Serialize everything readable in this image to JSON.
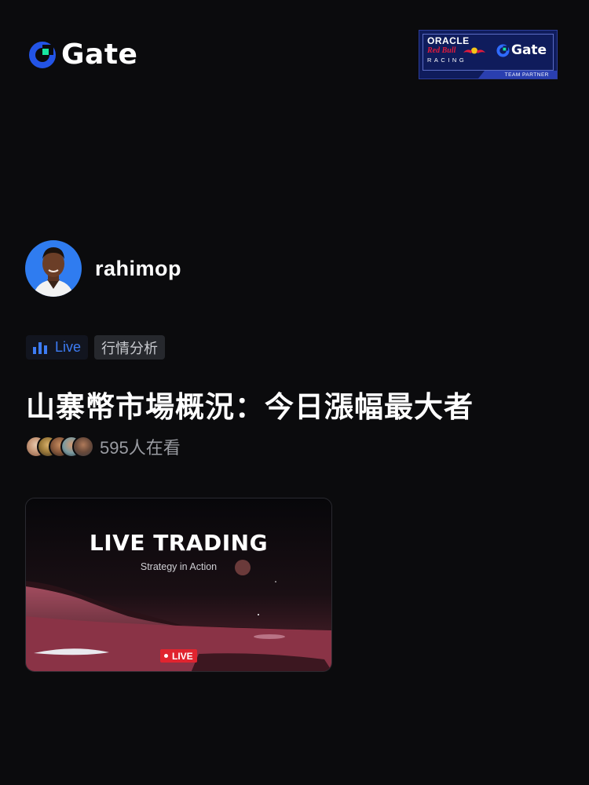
{
  "header": {
    "brand_name": "Gate",
    "brand_color": "#2354e6",
    "accent_green": "#17e6a1"
  },
  "partner_badge": {
    "line1": "ORACLE",
    "line2": "Red Bull",
    "line3": "RACING",
    "brand": "Gate",
    "caption": "TEAM PARTNER"
  },
  "user": {
    "name": "rahimop"
  },
  "tags": {
    "live": "Live",
    "category": "行情分析"
  },
  "post": {
    "title": "山寨幣市場概況：今日漲幅最大者"
  },
  "viewers": {
    "count_text": "595人在看"
  },
  "video": {
    "headline": "LIVE TRADING",
    "subtitle": "Strategy in Action",
    "live_label": "LIVE"
  }
}
